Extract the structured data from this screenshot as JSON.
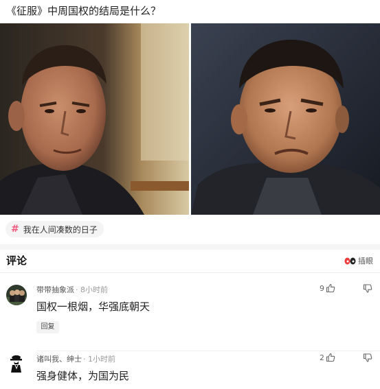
{
  "question": {
    "title": "《征服》中周国权的结局是什么？"
  },
  "topic": {
    "icon": "hash-icon",
    "label": "我在人间凑数的日子",
    "accent": "#f05a7e"
  },
  "comments_section": {
    "heading": "评论",
    "insert_meme_label": "插眼"
  },
  "comments": [
    {
      "username": "带带抽象派",
      "time": "· 8小时前",
      "text": "国权一根烟，华强底朝天",
      "likes": "9",
      "reply_label": "回复"
    },
    {
      "username": "诸叫我、绅士",
      "time": "· 1小时前",
      "text": "强身健体，为国为民",
      "likes": "2"
    }
  ]
}
